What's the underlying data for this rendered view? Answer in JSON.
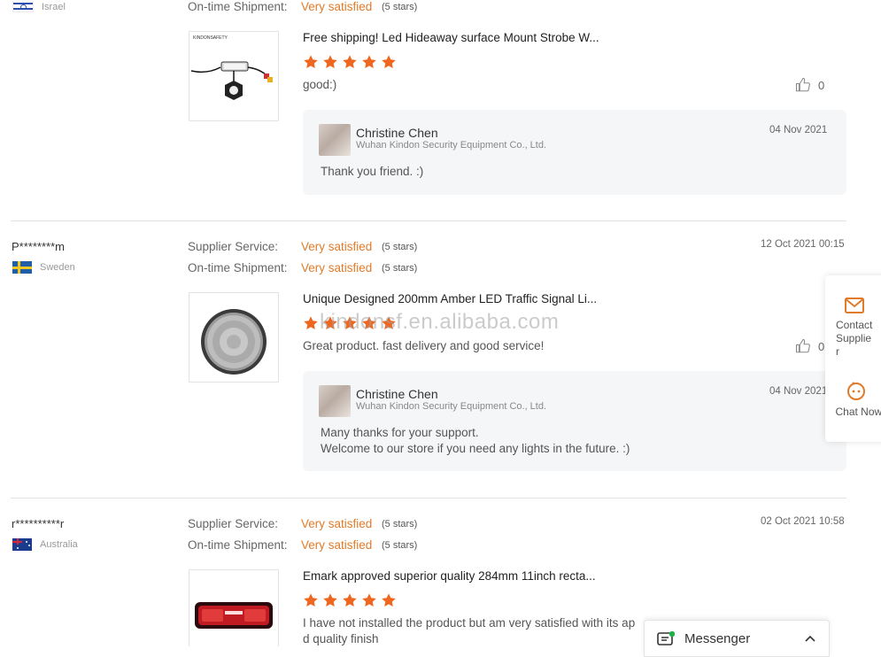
{
  "reviews": [
    {
      "buyer": "",
      "country": "Israel",
      "flag": "israel",
      "supplier_service_label": "",
      "supplier_service_value": "",
      "supplier_service_stars": "",
      "ontime_label": "On-time Shipment:",
      "ontime_value": "Very satisfied",
      "ontime_stars": "(5 stars)",
      "date": "",
      "product_title": "Free shipping! Led Hideaway surface Mount Strobe W...",
      "rating": 5,
      "comment": "good:)",
      "likes": "0",
      "reply": {
        "name": "Christine Chen",
        "company": "Wuhan Kindon Security Equipment Co., Ltd.",
        "date": "04 Nov 2021",
        "text": "Thank you friend. :)",
        "text2": ""
      }
    },
    {
      "buyer": "P********m",
      "country": "Sweden",
      "flag": "sweden",
      "supplier_service_label": "Supplier Service:",
      "supplier_service_value": "Very satisfied",
      "supplier_service_stars": "(5 stars)",
      "ontime_label": "On-time Shipment:",
      "ontime_value": "Very satisfied",
      "ontime_stars": "(5 stars)",
      "date": "12 Oct 2021 00:15",
      "product_title": "Unique Designed 200mm Amber LED Traffic Signal Li...",
      "rating": 5,
      "comment": "Great product. fast delivery and good service!",
      "likes": "0",
      "reply": {
        "name": "Christine Chen",
        "company": "Wuhan Kindon Security Equipment Co., Ltd.",
        "date": "04 Nov 2021",
        "text": "Many thanks for your support.",
        "text2": "Welcome to our store if you need any lights in the future. :)"
      }
    },
    {
      "buyer": "r**********r",
      "country": "Australia",
      "flag": "australia",
      "supplier_service_label": "Supplier Service:",
      "supplier_service_value": "Very satisfied",
      "supplier_service_stars": "(5 stars)",
      "ontime_label": "On-time Shipment:",
      "ontime_value": "Very satisfied",
      "ontime_stars": "(5 stars)",
      "date": "02 Oct 2021 10:58",
      "product_title": "Emark approved superior quality 284mm 11inch recta...",
      "rating": 5,
      "comment": "I have not installed the product but am very satisfied with its ap",
      "comment2": "d quality finish",
      "likes": "",
      "reply": null
    }
  ],
  "sidebar": {
    "contact_label_1": "Contact",
    "contact_label_2": "Supplie",
    "contact_label_3": "r",
    "chat_label": "Chat Now!"
  },
  "messenger": {
    "label": "Messenger"
  },
  "watermark": "kindonsf.en.alibaba.com",
  "colors": {
    "accent": "#e07b2a",
    "star": "#f0661f"
  }
}
